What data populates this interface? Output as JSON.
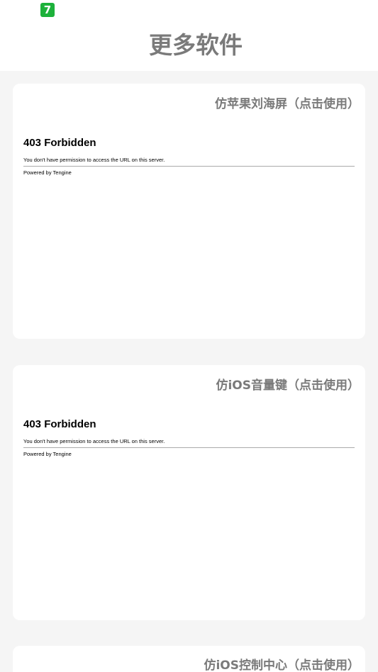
{
  "header": {
    "app_icon_glyph": "7",
    "title": "更多软件"
  },
  "cards": [
    {
      "title": "仿苹果刘海屏（点击使用）",
      "error": {
        "heading": "403 Forbidden",
        "message": "You don't have permission to access the URL on this server.",
        "footer": "Powered by Tengine"
      }
    },
    {
      "title": "仿iOS音量键（点击使用）",
      "error": {
        "heading": "403 Forbidden",
        "message": "You don't have permission to access the URL on this server.",
        "footer": "Powered by Tengine"
      }
    },
    {
      "title": "仿iOS控制中心（点击使用）"
    }
  ],
  "colors": {
    "background": "#f5f5f5",
    "card": "#ffffff",
    "title_gray": "#7a7a7a",
    "app_icon_green": "#1db13b"
  },
  "icons": {
    "app_icon": "app-logo-icon"
  }
}
